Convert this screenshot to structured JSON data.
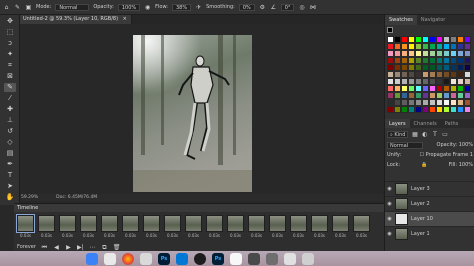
{
  "options_bar": {
    "mode_label": "Mode:",
    "mode_value": "Normal",
    "opacity_label": "Opacity:",
    "opacity_value": "100%",
    "flow_label": "Flow:",
    "flow_value": "38%",
    "smoothing_label": "Smoothing:",
    "smoothing_value": "0%",
    "angle_value": "0°"
  },
  "document": {
    "tab_title": "Untitled-2 @ 59.3% (Layer 10, RGB/8)",
    "zoom": "59.29%",
    "doc_size": "Doc: 6.45M/76.4M"
  },
  "timeline": {
    "title": "Timeline",
    "frame_durations": [
      "0.03s",
      "0.03s",
      "0.03s",
      "0.03s",
      "0.03s",
      "0.03s",
      "0.03s",
      "0.03s",
      "0.03s",
      "0.03s",
      "0.03s",
      "0.03s",
      "0.03s",
      "0.03s",
      "0.03s",
      "0.03s",
      "0.03s"
    ],
    "loop_label": "Forever"
  },
  "swatches_panel": {
    "tabs": [
      "Swatches",
      "Navigator"
    ],
    "colors": [
      "#ffffff",
      "#000000",
      "#ff0000",
      "#ffff00",
      "#00ff00",
      "#00ffff",
      "#0000ff",
      "#ff00ff",
      "#c0c0c0",
      "#808080",
      "#ff8000",
      "#8000ff",
      "#ed1c24",
      "#f26522",
      "#f7941d",
      "#fff200",
      "#8dc63f",
      "#39b54a",
      "#00a651",
      "#00a99d",
      "#00aeef",
      "#0072bc",
      "#2e3192",
      "#662d91",
      "#f49ac1",
      "#f5989d",
      "#f9ad81",
      "#fdc689",
      "#fff799",
      "#c4df9b",
      "#a3d39c",
      "#82ca9c",
      "#7accc8",
      "#6dcff6",
      "#7da7d9",
      "#8393ca",
      "#9e0b0f",
      "#a0410d",
      "#a36209",
      "#aba000",
      "#598527",
      "#1a7b30",
      "#007236",
      "#00746b",
      "#0076a3",
      "#004a80",
      "#003471",
      "#1b1464",
      "#790000",
      "#7b2e00",
      "#7d4900",
      "#827b00",
      "#406618",
      "#005e20",
      "#005826",
      "#005952",
      "#005b7f",
      "#003663",
      "#002157",
      "#0d004c",
      "#c7b299",
      "#998675",
      "#736357",
      "#534741",
      "#37302d",
      "#c69c6d",
      "#a67c52",
      "#8c6239",
      "#754c24",
      "#603913",
      "#3c2415",
      "#d9d9d9",
      "#e1e1e1",
      "#cccccc",
      "#b3b3b3",
      "#999999",
      "#808080",
      "#666666",
      "#4d4d4d",
      "#333333",
      "#1a1a1a",
      "#f0e6dc",
      "#e6d2c8",
      "#d2b4a0",
      "#ff6666",
      "#ffb366",
      "#ffff66",
      "#66ff66",
      "#66ffff",
      "#6666ff",
      "#ff66ff",
      "#b30000",
      "#b35900",
      "#b3b300",
      "#00b300",
      "#0000b3",
      "#993366",
      "#669933",
      "#336699",
      "#996633",
      "#339966",
      "#663399",
      "#cc9966",
      "#99cc66",
      "#6699cc",
      "#cc6699",
      "#66cc99",
      "#9966cc",
      "#2b2b2b",
      "#444444",
      "#5e5e5e",
      "#777777",
      "#909090",
      "#aaaaaa",
      "#c3c3c3",
      "#dddddd",
      "#f6f6f6",
      "#ffe4c4",
      "#deb887",
      "#a0522d",
      "#800000",
      "#808000",
      "#008000",
      "#008080",
      "#000080",
      "#800080",
      "#ff4500",
      "#ffd700",
      "#adff2f",
      "#40e0d0",
      "#1e90ff",
      "#ee82ee"
    ]
  },
  "layers_panel": {
    "tabs": [
      "Layers",
      "Channels",
      "Paths"
    ],
    "kind_label": "Kind",
    "blend_mode": "Normal",
    "opacity_label": "Opacity:",
    "opacity_value": "100%",
    "unify_label": "Unify:",
    "propagate_label": "Propagate Frame 1",
    "lock_label": "Lock:",
    "fill_label": "Fill:",
    "fill_value": "100%",
    "layers": [
      "Layer 3",
      "Layer 2",
      "Layer 10",
      "Layer 1"
    ]
  }
}
